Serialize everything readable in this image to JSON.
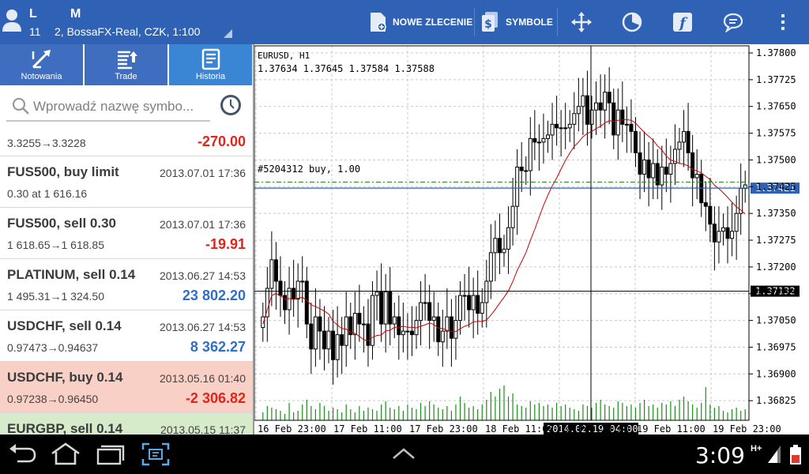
{
  "header": {
    "account_initial_1": "L",
    "account_initial_2": "M",
    "account_number": "11",
    "account_server": "2, BossaFX-Real, CZK, 1:100",
    "new_order_label": "NOWE ZLECENIE",
    "symbols_label": "SYMBOLE"
  },
  "tabs": [
    {
      "label": "Notowania",
      "active": false
    },
    {
      "label": "Trade",
      "active": false
    },
    {
      "label": "Historia",
      "active": true
    }
  ],
  "search": {
    "placeholder": "Wprowadź nazwę symbo..."
  },
  "history": [
    {
      "title": "",
      "time": "",
      "detail": "3.3255→3.3228",
      "profit": "-270.00",
      "profit_sign": "neg",
      "highlight": "none"
    },
    {
      "title": "FUS500, buy limit",
      "time": "2013.07.01 17:36",
      "detail": "0.30 at 1 616.16",
      "profit": "",
      "profit_sign": "neg",
      "highlight": "none"
    },
    {
      "title": "FUS500, sell 0.30",
      "time": "2013.07.01 17:36",
      "detail": "1 618.65→1 618.85",
      "profit": "-19.91",
      "profit_sign": "neg",
      "highlight": "none"
    },
    {
      "title": "PLATINUM, sell 0.14",
      "time": "2013.06.27 14:53",
      "detail": "1 495.31→1 324.50",
      "profit": "23 802.20",
      "profit_sign": "pos",
      "highlight": "none"
    },
    {
      "title": "USDCHF, sell 0.14",
      "time": "2013.06.27 14:53",
      "detail": "0.97473→0.94637",
      "profit": "8 362.27",
      "profit_sign": "pos",
      "highlight": "none"
    },
    {
      "title": "USDCHF, buy 0.14",
      "time": "2013.05.16 01:40",
      "detail": "0.97238→0.96450",
      "profit": "-2 306.82",
      "profit_sign": "neg",
      "highlight": "pink"
    },
    {
      "title": "EURGBP, sell 0.14",
      "time": "2013.05.15 11:37",
      "detail": "",
      "profit": "",
      "profit_sign": "neg",
      "highlight": "green"
    }
  ],
  "chart": {
    "symbol_label": "EURUSD, H1",
    "ohlc_label": "1.37634 1.37645 1.37584 1.37588",
    "order_label": "#5204312 buy, 1.00",
    "bid_price_label": "1.37421",
    "crosshair_price_label": "1.37132",
    "crosshair_time_label": "2014.02.19 04:00"
  },
  "chart_data": {
    "type": "candlestick",
    "title": "EURUSD, H1",
    "ylim": [
      1.3677,
      1.3782
    ],
    "y_ticks": [
      "1.37800",
      "1.37725",
      "1.37650",
      "1.37575",
      "1.37500",
      "1.37425",
      "1.37350",
      "1.37275",
      "1.37200",
      "1.37125",
      "1.37050",
      "1.36975",
      "1.36900",
      "1.36825"
    ],
    "x_ticks": [
      "16 Feb 23:00",
      "17 Feb 11:00",
      "17 Feb 23:00",
      "18 Feb 11:00",
      "18 Feb 23:00",
      "19 Feb 11:00",
      "19 Feb 23:00"
    ],
    "order_price": 1.37438,
    "bid_price": 1.37421,
    "crosshair_price": 1.37132,
    "crosshair_time": "2014.02.19 04:00",
    "close": [
      1.3706,
      1.3714,
      1.3722,
      1.3716,
      1.3712,
      1.3708,
      1.3714,
      1.3711,
      1.3716,
      1.3716,
      1.3704,
      1.3697,
      1.3706,
      1.3702,
      1.3697,
      1.3702,
      1.3694,
      1.3701,
      1.3698,
      1.3706,
      1.3701,
      1.3707,
      1.3704,
      1.3704,
      1.3698,
      1.3712,
      1.3713,
      1.3704,
      1.3713,
      1.3704,
      1.3706,
      1.3701,
      1.3702,
      1.3702,
      1.3701,
      1.3705,
      1.371,
      1.371,
      1.3705,
      1.3706,
      1.3699,
      1.3702,
      1.3706,
      1.37,
      1.3705,
      1.3712,
      1.3712,
      1.3708,
      1.3712,
      1.3707,
      1.371,
      1.3716,
      1.3724,
      1.3728,
      1.3724,
      1.3725,
      1.3731,
      1.3737,
      1.3748,
      1.3747,
      1.3747,
      1.3756,
      1.3755,
      1.3755,
      1.3756,
      1.3757,
      1.376,
      1.3759,
      1.3759,
      1.3759,
      1.376,
      1.3763,
      1.3765,
      1.3768,
      1.376,
      1.3764,
      1.3766,
      1.3764,
      1.3769,
      1.3766,
      1.3757,
      1.3764,
      1.376,
      1.376,
      1.3758,
      1.3752,
      1.3746,
      1.375,
      1.3745,
      1.3749,
      1.3743,
      1.3748,
      1.3746,
      1.3749,
      1.3753,
      1.3755,
      1.3758,
      1.3752,
      1.3745,
      1.3746,
      1.3738,
      1.3737,
      1.3732,
      1.3727,
      1.373,
      1.3731,
      1.3728,
      1.373,
      1.3735,
      1.3742,
      1.3743
    ],
    "volume": [
      10,
      18,
      16,
      14,
      12,
      8,
      22,
      10,
      12,
      20,
      26,
      18,
      14,
      22,
      18,
      12,
      16,
      14,
      10,
      20,
      14,
      10,
      18,
      12,
      16,
      14,
      12,
      20,
      24,
      16,
      14,
      18,
      12,
      20,
      16,
      14,
      22,
      18,
      24,
      20,
      16,
      14,
      18,
      12,
      20,
      30,
      22,
      16,
      18,
      14,
      20,
      26,
      36,
      30,
      40,
      44,
      30,
      34,
      20,
      18,
      16,
      24,
      20,
      22,
      18,
      20,
      16,
      22,
      18,
      20,
      16,
      14,
      12,
      20,
      18,
      16,
      22,
      26,
      20,
      18,
      16,
      24,
      22,
      18,
      20,
      16,
      22,
      26,
      18,
      20,
      16,
      22,
      20,
      24,
      18,
      26,
      30,
      24,
      20,
      16,
      22,
      42,
      20,
      16,
      18,
      12,
      10,
      14,
      16,
      12,
      14
    ]
  }
}
